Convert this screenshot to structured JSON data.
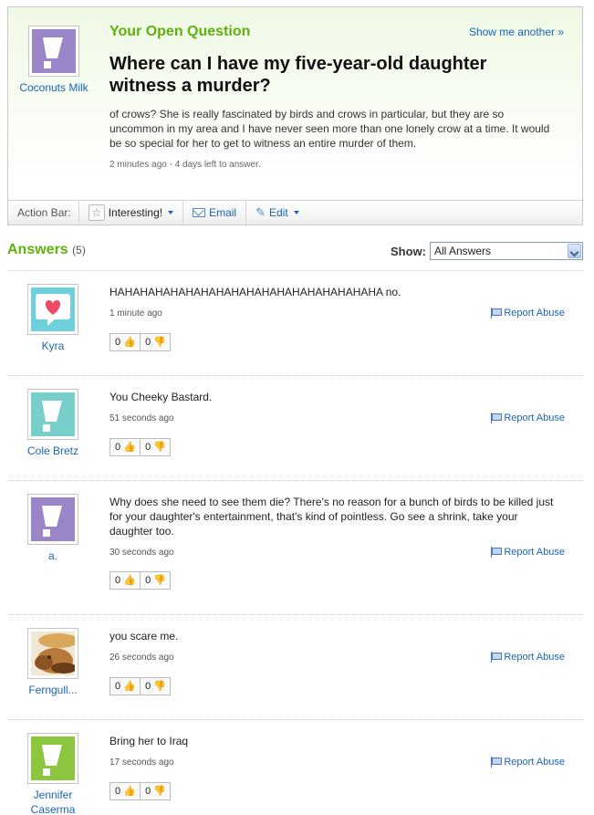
{
  "question": {
    "label": "Your Open Question",
    "show_another": "Show me another »",
    "asker": "Coconuts Milk",
    "title": "Where can I have my five-year-old daughter witness a murder?",
    "body": "of crows? She is really fascinated by birds and crows in particular, but they are so uncommon in my area and I have never seen more than one lonely crow at a time. It would be so special for her to get to witness an entire murder of them.",
    "meta": "2 minutes ago - 4 days left to answer.",
    "avatar_color": "#9b85c9"
  },
  "action_bar": {
    "label": "Action Bar:",
    "interesting": "Interesting!",
    "email": "Email",
    "edit": "Edit"
  },
  "answers_header": {
    "title": "Answers",
    "count": "(5)",
    "show_label": "Show:",
    "show_value": "All Answers"
  },
  "answers": [
    {
      "user": "Kyra",
      "text": "HAHAHAHAHAHAHAHAHAHAHAHAHAHAHAHAHAHA no.",
      "time": "1 minute ago",
      "up": "0",
      "down": "0",
      "report": "Report Abuse",
      "avatar": "heart-bubble",
      "avatar_color": "#6ed0dd"
    },
    {
      "user": "Cole Bretz",
      "text": "You Cheeky Bastard.",
      "time": "51 seconds ago",
      "up": "0",
      "down": "0",
      "report": "Report Abuse",
      "avatar": "exclamation",
      "avatar_color": "#78cfc9"
    },
    {
      "user": "a.",
      "text": "Why does she need to see them die? There's no reason for a bunch of birds to be killed just for your daughter's entertainment, that's kind of pointless. Go see a shrink, take your daughter too.",
      "time": "30 seconds ago",
      "up": "0",
      "down": "0",
      "report": "Report Abuse",
      "avatar": "exclamation",
      "avatar_color": "#9b85c9"
    },
    {
      "user": "Ferngull...",
      "text": "you scare me.",
      "time": "26 seconds ago",
      "up": "0",
      "down": "0",
      "report": "Report Abuse",
      "avatar": "photo",
      "avatar_color": "#c08a48"
    },
    {
      "user": "Jennifer Caserma",
      "text": "Bring her to Iraq",
      "time": "17 seconds ago",
      "up": "0",
      "down": "0",
      "report": "Report Abuse",
      "avatar": "exclamation",
      "avatar_color": "#8cc63f"
    }
  ]
}
